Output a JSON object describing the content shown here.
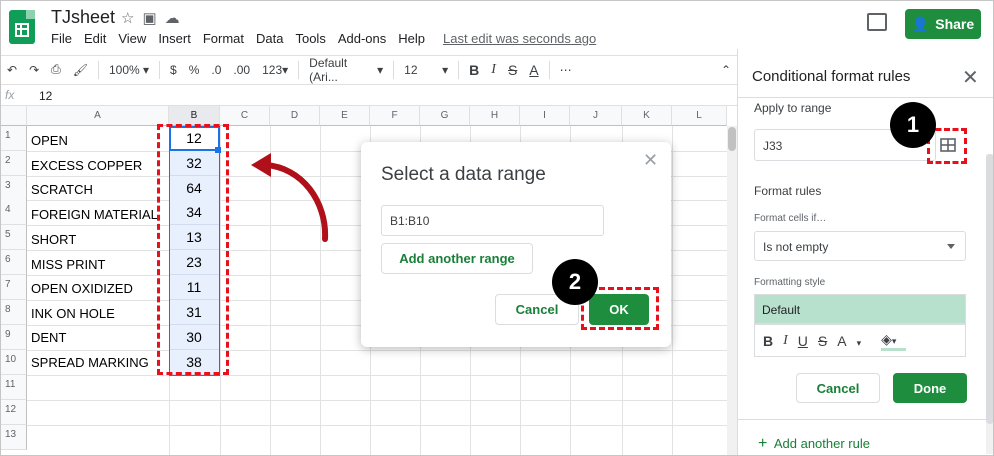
{
  "app": {
    "doc_title": "TJsheet",
    "menu": [
      "File",
      "Edit",
      "View",
      "Insert",
      "Format",
      "Data",
      "Tools",
      "Add-ons",
      "Help"
    ],
    "last_edit": "Last edit was seconds ago",
    "share_label": "Share"
  },
  "toolbar": {
    "zoom": "100%",
    "currency": "$",
    "percent": "%",
    "dec_less": ".0",
    "dec_more": ".00",
    "more_formats": "123",
    "font": "Default (Ari...",
    "font_size": "12",
    "bold": "B",
    "italic": "I",
    "strike": "S",
    "text_color": "A",
    "more": "⋯"
  },
  "formula_bar": {
    "fx": "fx",
    "value": "12"
  },
  "columns": [
    "A",
    "B",
    "C",
    "D",
    "E",
    "F",
    "G",
    "H",
    "I",
    "J",
    "K",
    "L"
  ],
  "rows": [
    {
      "n": "1",
      "a": "OPEN",
      "b": "12"
    },
    {
      "n": "2",
      "a": "EXCESS COPPER",
      "b": "32"
    },
    {
      "n": "3",
      "a": "SCRATCH",
      "b": "64"
    },
    {
      "n": "4",
      "a": "FOREIGN MATERIAL",
      "b": "34"
    },
    {
      "n": "5",
      "a": "SHORT",
      "b": "13"
    },
    {
      "n": "6",
      "a": "MISS PRINT",
      "b": "23"
    },
    {
      "n": "7",
      "a": "OPEN OXIDIZED",
      "b": "11"
    },
    {
      "n": "8",
      "a": "INK ON HOLE",
      "b": "31"
    },
    {
      "n": "9",
      "a": "DENT",
      "b": "30"
    },
    {
      "n": "10",
      "a": "SPREAD MARKING",
      "b": "38"
    },
    {
      "n": "11",
      "a": "",
      "b": ""
    },
    {
      "n": "12",
      "a": "",
      "b": ""
    },
    {
      "n": "13",
      "a": "",
      "b": ""
    }
  ],
  "dialog": {
    "title": "Select a data range",
    "range_value": "B1:B10",
    "add_range": "Add another range",
    "cancel": "Cancel",
    "ok": "OK"
  },
  "steps": {
    "one": "1",
    "two": "2"
  },
  "panel": {
    "title": "Conditional format rules",
    "apply_label": "Apply to range",
    "range_value": "J33",
    "format_rules": "Format rules",
    "cells_if": "Format cells if…",
    "condition": "Is not empty",
    "formatting_style": "Formatting style",
    "style_preview": "Default",
    "fmt_bold": "B",
    "fmt_italic": "I",
    "fmt_underline": "U",
    "fmt_strike": "S",
    "fmt_color": "A",
    "cancel": "Cancel",
    "done": "Done",
    "add_rule": "Add another rule"
  },
  "colors": {
    "green": "#1e8e3e",
    "annotation_red": "#e8101a",
    "preview_fill": "#b7e1cd"
  }
}
